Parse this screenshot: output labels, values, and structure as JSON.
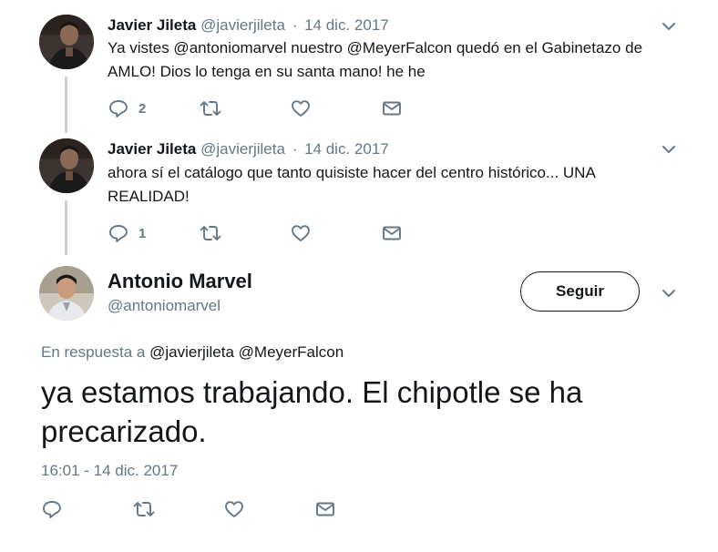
{
  "thread": [
    {
      "name": "Javier Jileta",
      "handle": "@javierjileta",
      "separator": "·",
      "date": "14 dic. 2017",
      "text": "Ya vistes @antoniomarvel nuestro @MeyerFalcon quedó en el Gabinetazo de AMLO! Dios lo tenga en su santa mano! he he",
      "reply_count": "2",
      "retweet_count": "",
      "like_count": ""
    },
    {
      "name": "Javier Jileta",
      "handle": "@javierjileta",
      "separator": "·",
      "date": "14 dic. 2017",
      "text": "ahora sí el catálogo que tanto quisiste hacer del centro histórico... UNA REALIDAD!",
      "reply_count": "1",
      "retweet_count": "",
      "like_count": ""
    }
  ],
  "main_tweet": {
    "name": "Antonio Marvel",
    "handle": "@antoniomarvel",
    "follow_label": "Seguir",
    "reply_prefix": "En respuesta a",
    "reply_mentions": "@javierjileta @MeyerFalcon",
    "text": "ya estamos trabajando. El chipotle se ha precarizado.",
    "timestamp": "16:01 - 14 dic. 2017"
  },
  "icons": {
    "reply": "reply-icon",
    "retweet": "retweet-icon",
    "like": "heart-icon",
    "message": "envelope-icon",
    "more": "chevron-down-icon"
  },
  "colors": {
    "text": "#14171a",
    "muted": "#657786",
    "thread_line": "#cccccc",
    "background": "#ffffff"
  }
}
